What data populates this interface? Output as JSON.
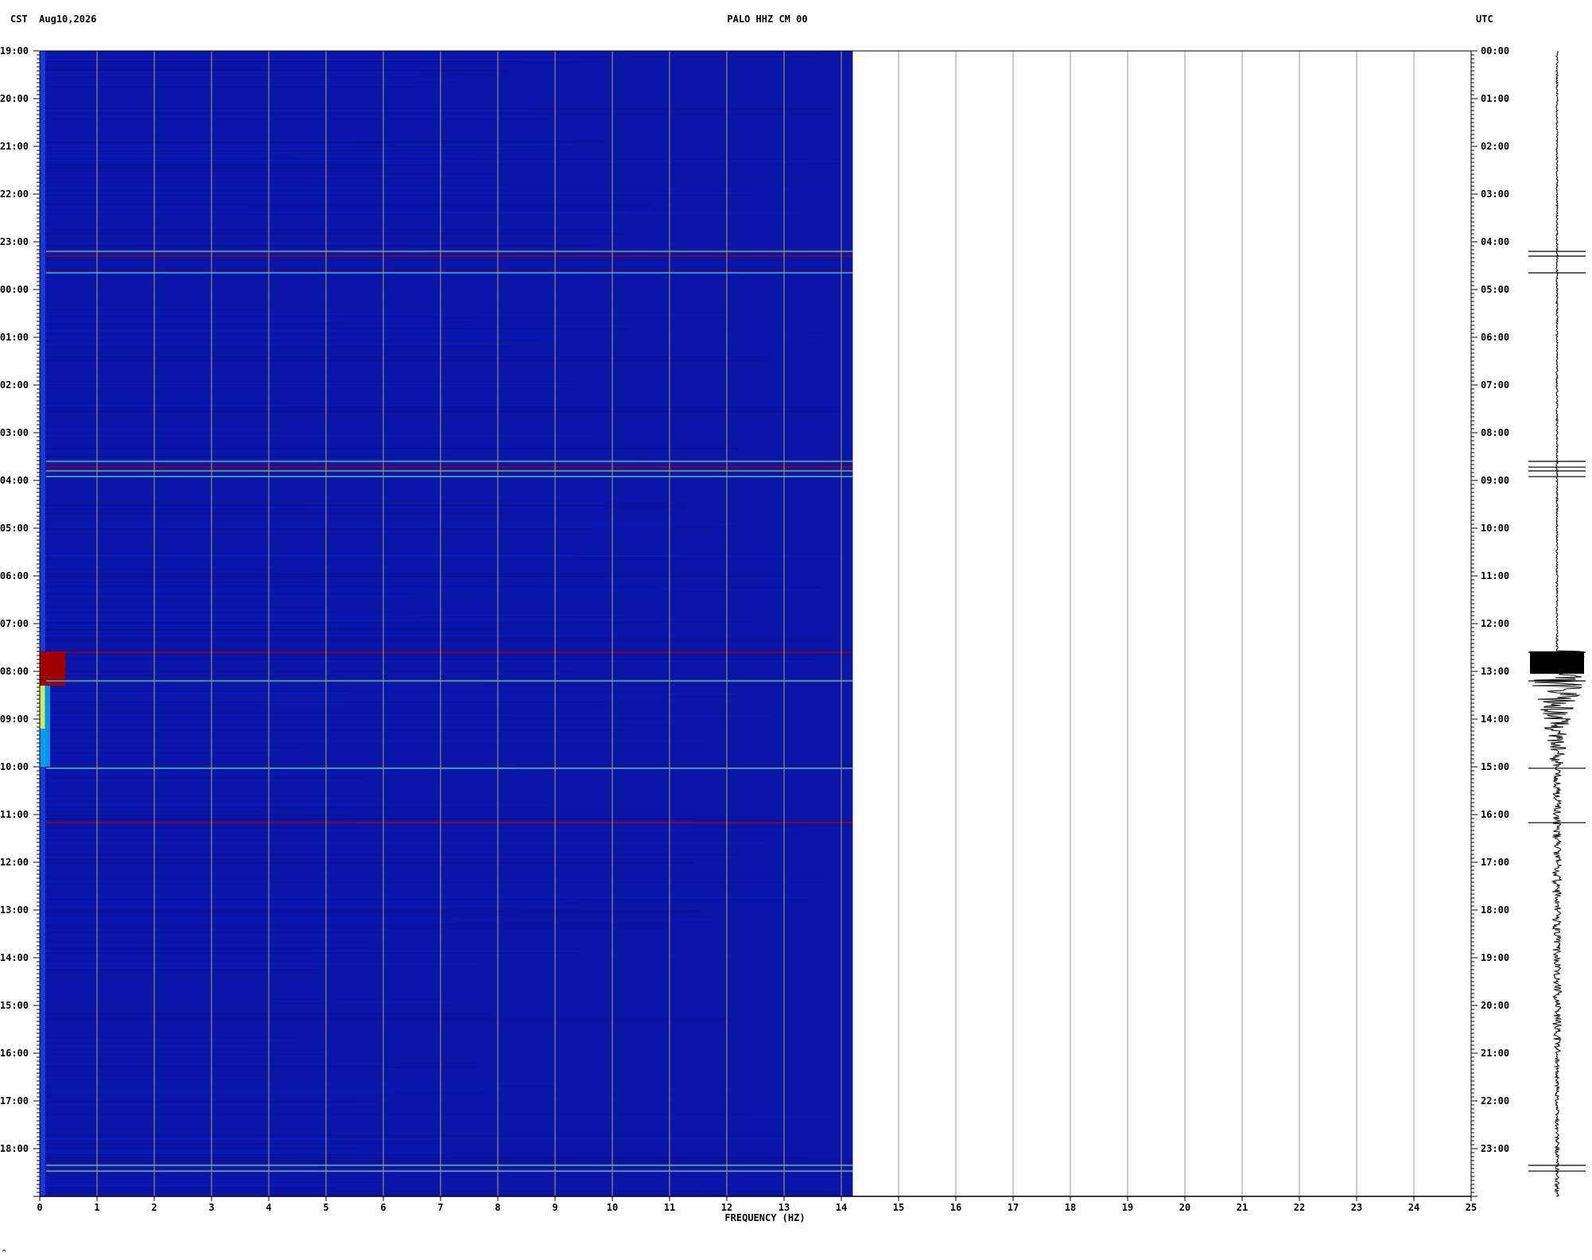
{
  "header": {
    "left_timezone": "CST",
    "date": "Aug10,2026",
    "station": "PALO HHZ CM 00",
    "right_timezone": "UTC"
  },
  "footer_mark": "^",
  "chart_data": {
    "type": "heatmap",
    "title": "PALO HHZ CM 00",
    "xlabel": "FREQUENCY (HZ)",
    "x_ticks": [
      "0",
      "1",
      "2",
      "3",
      "4",
      "5",
      "6",
      "7",
      "8",
      "9",
      "10",
      "11",
      "12",
      "13",
      "14",
      "15",
      "16",
      "17",
      "18",
      "19",
      "20",
      "21",
      "22",
      "23",
      "24",
      "25"
    ],
    "xlim": [
      0,
      25
    ],
    "data_extent_hz": 14.2,
    "left_axis_ticks": [
      "19:00",
      "20:00",
      "21:00",
      "22:00",
      "23:00",
      "00:00",
      "01:00",
      "02:00",
      "03:00",
      "04:00",
      "05:00",
      "06:00",
      "07:00",
      "08:00",
      "09:00",
      "10:00",
      "11:00",
      "12:00",
      "13:00",
      "14:00",
      "15:00",
      "16:00",
      "17:00",
      "18:00"
    ],
    "right_axis_ticks": [
      "00:00",
      "01:00",
      "02:00",
      "03:00",
      "04:00",
      "05:00",
      "06:00",
      "07:00",
      "08:00",
      "09:00",
      "10:00",
      "11:00",
      "12:00",
      "13:00",
      "14:00",
      "15:00",
      "16:00",
      "17:00",
      "18:00",
      "19:00",
      "20:00",
      "21:00",
      "22:00",
      "23:00"
    ],
    "time_span_hours": 24,
    "grid": true,
    "colors": {
      "background": "#0a14a6",
      "low": "#0818b8",
      "mid": "#00c8ff",
      "high": "#ffff40",
      "max": "#a00000",
      "gridline": "#a8a860"
    },
    "event_lines_utc_hours": [
      4.2,
      4.3,
      4.65,
      8.6,
      8.72,
      8.8,
      8.92,
      12.6,
      13.2,
      15.03,
      16.17,
      23.35,
      23.47
    ],
    "major_event": {
      "start_utc_hours": 12.58,
      "strong_until_utc_hours": 13.3,
      "decay_until_utc_hours": 15.0
    }
  }
}
